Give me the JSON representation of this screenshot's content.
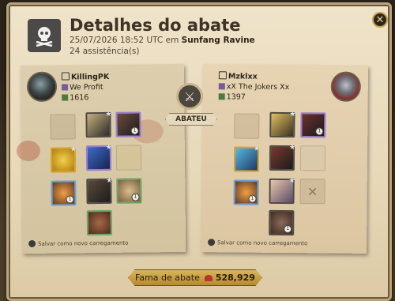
{
  "header": {
    "title": "Detalhes do abate",
    "datetime": "25/07/2026 18:52 UTC em",
    "location": "Sunfang Ravine",
    "assists": "24 assistência(s)",
    "icon": "skull-icon"
  },
  "killer": {
    "name": "KillingPK",
    "guild": "We Profit",
    "item_power": "1616",
    "save_label": "Salvar como novo carregamento"
  },
  "victim": {
    "name": "Mzklxx",
    "guild": "xX The Jokers Xx",
    "item_power": "1397",
    "save_label": "Salvar como novo carregamento"
  },
  "kill_label": "ABATEU",
  "fame": {
    "label": "Fama de abate",
    "value": "528,929"
  },
  "slot_count_labels": [
    "1",
    "1",
    "1",
    "1",
    "1",
    "1"
  ],
  "colors": {
    "tier_gold": "#d7a42b",
    "tier_purple": "#9b7ccf",
    "tier_blue": "#6da2d6",
    "tier_green": "#6aa56a"
  }
}
